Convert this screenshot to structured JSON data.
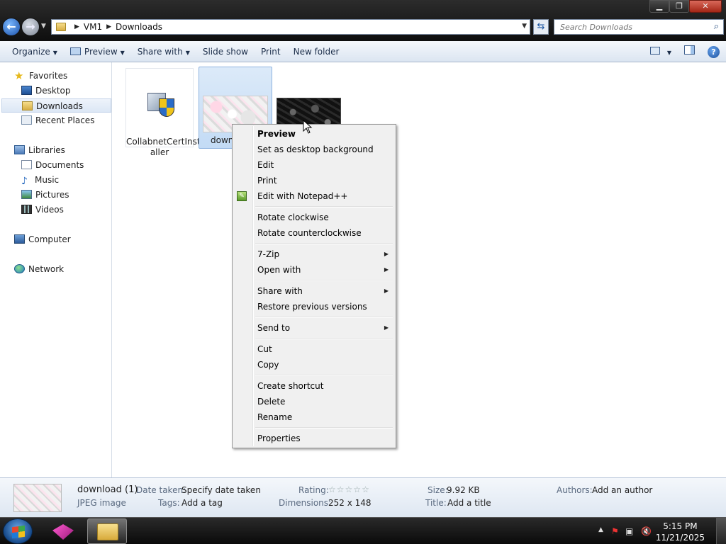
{
  "window": {
    "minimize": "▁",
    "maximize": "❐",
    "close": "✕"
  },
  "address": {
    "crumbs": [
      "VM1",
      "Downloads"
    ]
  },
  "search": {
    "placeholder": "Search Downloads"
  },
  "toolbar": {
    "organize": "Organize",
    "preview": "Preview",
    "share_with": "Share with",
    "slide_show": "Slide show",
    "print": "Print",
    "new_folder": "New folder"
  },
  "navpane": {
    "favorites": "Favorites",
    "desktop": "Desktop",
    "downloads": "Downloads",
    "recent_places": "Recent Places",
    "libraries": "Libraries",
    "documents": "Documents",
    "music": "Music",
    "pictures": "Pictures",
    "videos": "Videos",
    "computer": "Computer",
    "network": "Network"
  },
  "files": [
    {
      "name": "CollabnetCertInstaller",
      "name_line1": "CollabnetCertInst",
      "name_line2": "aller",
      "icon": "installer-icon"
    },
    {
      "name": "download (1)",
      "visible_name": "down",
      "icon": "image-thumbnail",
      "selected": true
    },
    {
      "name": "",
      "icon": "image-thumbnail-dark"
    }
  ],
  "context_menu": {
    "items": [
      {
        "label": "Preview",
        "default": true
      },
      {
        "label": "Set as desktop background"
      },
      {
        "label": "Edit"
      },
      {
        "label": "Print"
      },
      {
        "label": "Edit with Notepad++",
        "icon": "notepadpp-icon"
      },
      {
        "label": "Rotate clockwise"
      },
      {
        "label": "Rotate counterclockwise"
      },
      {
        "label": "7-Zip",
        "submenu": true
      },
      {
        "label": "Open with",
        "submenu": true
      },
      {
        "label": "Share with",
        "submenu": true
      },
      {
        "label": "Restore previous versions"
      },
      {
        "label": "Send to",
        "submenu": true
      },
      {
        "label": "Cut"
      },
      {
        "label": "Copy"
      },
      {
        "label": "Create shortcut"
      },
      {
        "label": "Delete"
      },
      {
        "label": "Rename"
      },
      {
        "label": "Properties"
      }
    ]
  },
  "details": {
    "name": "download (1)",
    "type": "JPEG image",
    "date_taken_label": "Date taken:",
    "date_taken_value": "Specify date taken",
    "tags_label": "Tags:",
    "tags_value": "Add a tag",
    "rating_label": "Rating:",
    "rating_stars": 0,
    "dimensions_label": "Dimensions:",
    "dimensions_value": "252 x 148",
    "size_label": "Size:",
    "size_value": "9.92 KB",
    "title_label": "Title:",
    "title_value": "Add a title",
    "authors_label": "Authors:",
    "authors_value": "Add an author"
  },
  "taskbar": {
    "time": "5:15 PM",
    "date": "11/21/2025"
  }
}
